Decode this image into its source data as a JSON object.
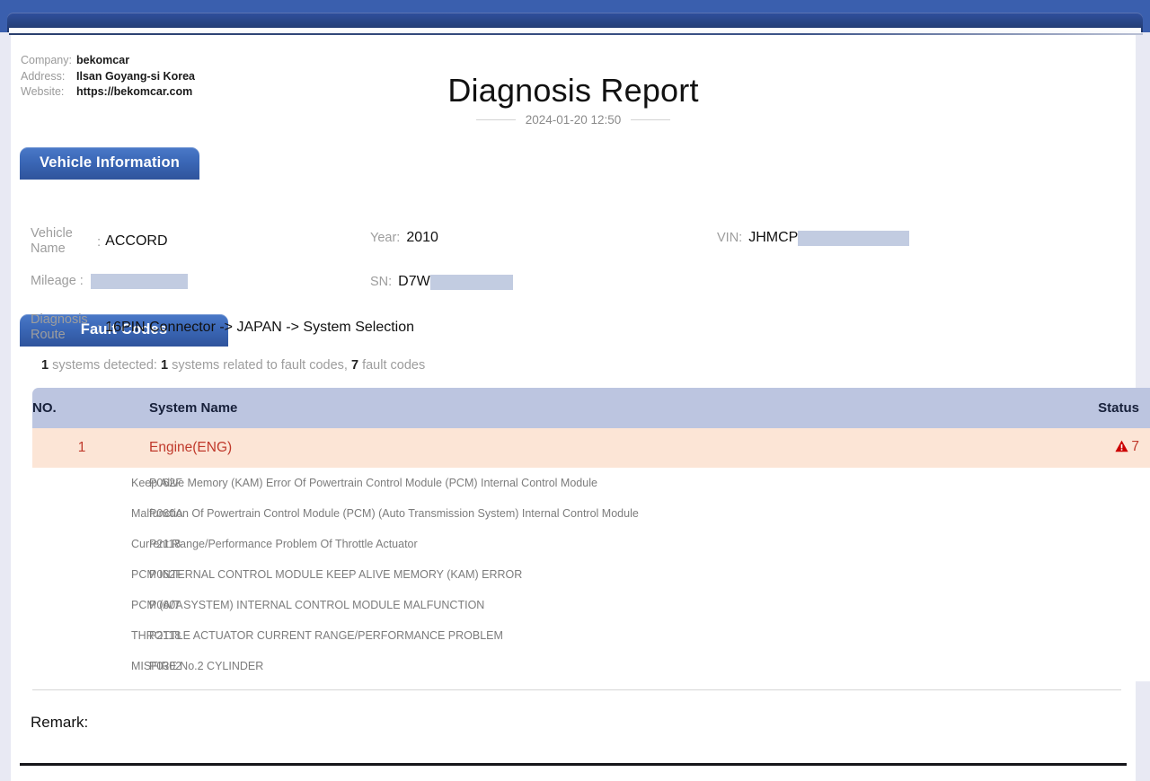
{
  "company": {
    "rows": [
      {
        "label": "Company:",
        "value": "bekomcar"
      },
      {
        "label": "Address:",
        "value": "Ilsan Goyang-si Korea"
      },
      {
        "label": "Website:",
        "value": "https://bekomcar.com"
      }
    ]
  },
  "header": {
    "title": "Diagnosis Report",
    "date": "2024-01-20 12:50"
  },
  "vehicle_section": {
    "tab_label": "Vehicle Information",
    "vehicle_name_label": "Vehicle Name",
    "vehicle_name_value": "ACCORD",
    "year_label": "Year:",
    "year_value": "2010",
    "vin_label": "VIN:",
    "vin_value": "JHMCP",
    "mileage_label": "Mileage :",
    "mileage_value": "",
    "sn_label": "SN:",
    "sn_value": "D7W",
    "route_label": "Diagnosis Route",
    "route_value": "16PIN Connector -> JAPAN -> System Selection"
  },
  "fault_section": {
    "tab_label": "Fault Codes",
    "summary": {
      "systems_detected_count": "1",
      "systems_detected_text": " systems detected: ",
      "systems_related_count": "1",
      "systems_related_text": " systems related to fault codes, ",
      "fault_codes_count": "7",
      "fault_codes_text": " fault codes"
    },
    "columns": {
      "no": "NO.",
      "system_name": "System Name",
      "status": "Status"
    },
    "system": {
      "no": "1",
      "name": "Engine(ENG)",
      "status_count": "7"
    },
    "codes": [
      {
        "code": "P062F",
        "description": "Keep Alive Memory (KAM) Error Of Powertrain Control Module (PCM) Internal Control Module"
      },
      {
        "code": "P060A",
        "description": "Malfunction Of Powertrain Control Module (PCM) (Auto Transmission System) Internal Control Module"
      },
      {
        "code": "P2118",
        "description": "Current Range/Performance Problem Of Throttle Actuator"
      },
      {
        "code": "P062F",
        "description": "PCM INTERNAL CONTROL MODULE KEEP ALIVE MEMORY (KAM) ERROR"
      },
      {
        "code": "P060A",
        "description": "PCM (A/T SYSTEM) INTERNAL CONTROL MODULE MALFUNCTION"
      },
      {
        "code": "P2118",
        "description": "THROTTLE ACTUATOR CURRENT RANGE/PERFORMANCE PROBLEM"
      },
      {
        "code": "P0302",
        "description": "MISFIRE No.2 CYLINDER"
      }
    ]
  },
  "remark": {
    "label": "Remark:"
  },
  "colors": {
    "chrome_blue": "#3a5fae",
    "tab_blue": "#3a66b5",
    "table_header": "#bcc5e0",
    "system_row_bg": "#fce5d6",
    "system_row_text": "#c0392b",
    "redaction": "#c2cce1"
  }
}
